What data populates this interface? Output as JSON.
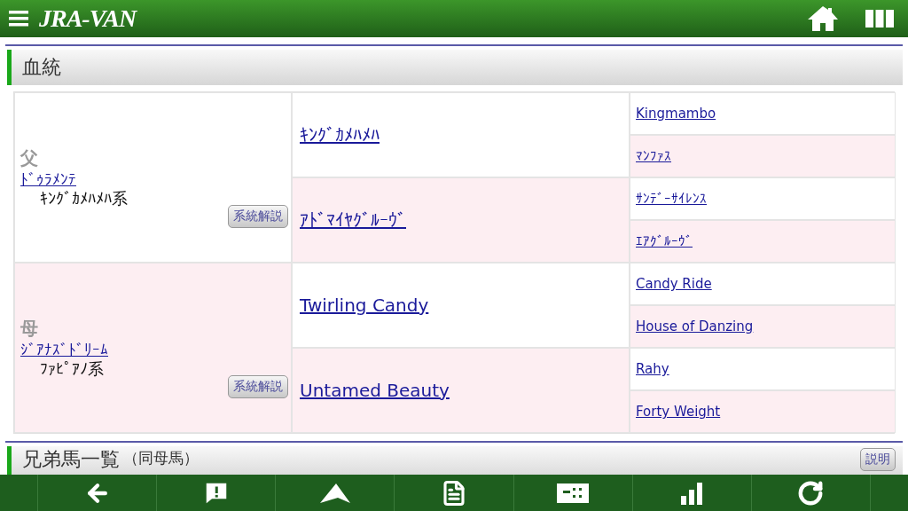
{
  "header": {
    "logo": "JRA-VAN"
  },
  "pedigree_section": {
    "title": "血統"
  },
  "pedigree": [
    {
      "role": "父",
      "name": "ﾄﾞｩﾗﾒﾝﾃ",
      "line": "ｷﾝｸﾞｶﾒﾊﾒﾊ系",
      "button": "系統解説",
      "parents": [
        {
          "name": "ｷﾝｸﾞｶﾒﾊﾒﾊ",
          "parents": [
            "Kingmambo",
            "ﾏﾝﾌｧｽ"
          ]
        },
        {
          "name": "ｱﾄﾞﾏｲﾔｸﾞﾙｰｳﾞ",
          "parents": [
            "ｻﾝﾃﾞｰｻｲﾚﾝｽ",
            "ｴｱｸﾞﾙｰｳﾞ"
          ]
        }
      ]
    },
    {
      "role": "母",
      "name": "ｼﾞｱﾅｽﾞﾄﾞﾘｰﾑ",
      "line": "ﾌｧﾋﾟｱﾉ系",
      "button": "系統解説",
      "parents": [
        {
          "name": "Twirling Candy",
          "parents": [
            "Candy Ride",
            "House of Danzing"
          ]
        },
        {
          "name": "Untamed Beauty",
          "parents": [
            "Rahy",
            "Forty Weight"
          ]
        }
      ]
    }
  ],
  "siblings_section": {
    "title": "兄弟馬一覧",
    "subtitle": "（同母馬）",
    "button": "説明"
  }
}
